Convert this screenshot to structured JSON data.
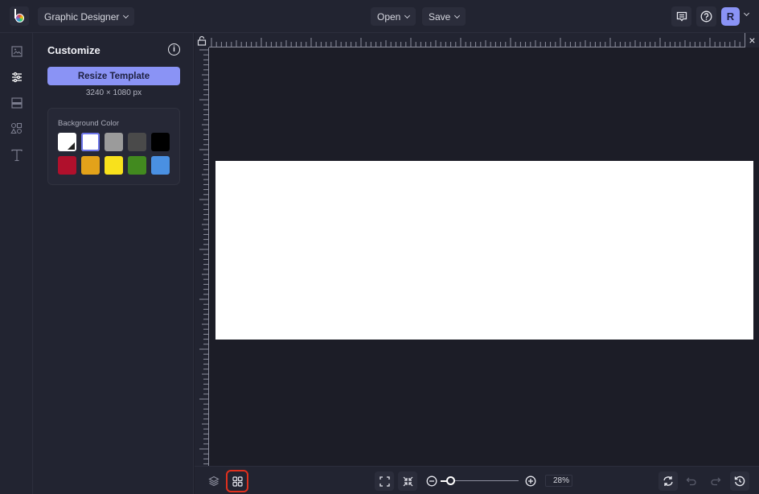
{
  "header": {
    "app_mode": "Graphic Designer",
    "open_label": "Open",
    "save_label": "Save",
    "user_initial": "R",
    "icons": [
      "logo",
      "comment-icon",
      "help-icon",
      "avatar",
      "chevron-down-icon"
    ]
  },
  "rail": {
    "items": [
      {
        "name": "image",
        "icon": "image-icon",
        "active": false
      },
      {
        "name": "customize",
        "icon": "sliders-icon",
        "active": true
      },
      {
        "name": "layout",
        "icon": "layout-icon",
        "active": false
      },
      {
        "name": "graphics",
        "icon": "shapes-icon",
        "active": false
      },
      {
        "name": "text",
        "icon": "text-icon",
        "active": false
      }
    ]
  },
  "panel": {
    "title": "Customize",
    "resize_label": "Resize Template",
    "dimensions": "3240 × 1080 px",
    "background": {
      "label": "Background Color",
      "swatches": [
        {
          "color": "#ffffff",
          "type": "custom-picker"
        },
        {
          "color": "#ffffff",
          "selected": true
        },
        {
          "color": "#9b9b9b"
        },
        {
          "color": "#4a4a4a"
        },
        {
          "color": "#000000"
        },
        {
          "color": "#b0102c"
        },
        {
          "color": "#e3a21a"
        },
        {
          "color": "#f8e11c"
        },
        {
          "color": "#428a1f"
        },
        {
          "color": "#4a90e2"
        }
      ]
    }
  },
  "canvas": {
    "artboard_color": "#ffffff",
    "close_label": "×"
  },
  "bottombar": {
    "zoom_value": "28%",
    "zoom_percent": 28,
    "tools": [
      "layers-icon",
      "grid-icon",
      "fit-screen-icon",
      "collapse-icon",
      "zoom-out-icon",
      "zoom-in-icon",
      "refresh-icon",
      "undo-icon",
      "redo-icon",
      "history-icon"
    ]
  },
  "colors": {
    "accent": "#8a93f5",
    "highlight": "#e0301e",
    "background": "#1e1f2a"
  }
}
